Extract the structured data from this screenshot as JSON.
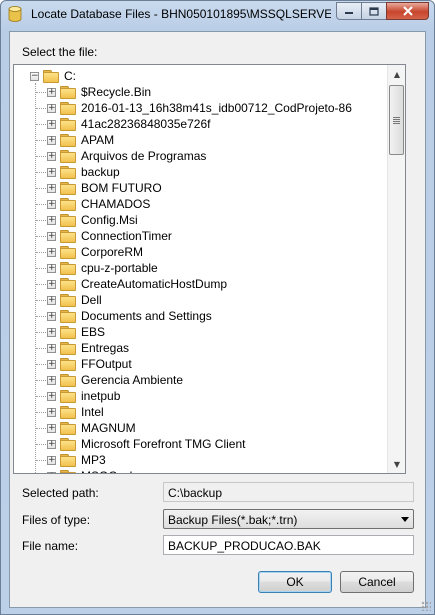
{
  "window": {
    "title": "Locate Database Files - BHN050101895\\MSSQLSERVE...",
    "icon": "database-icon"
  },
  "tree": {
    "label": "Select the file:",
    "root": {
      "label": "C:",
      "expanded": true
    },
    "items": [
      "$Recycle.Bin",
      "2016-01-13_16h38m41s_idb00712_CodProjeto-86",
      "41ac28236848035e726f",
      "APAM",
      "Arquivos de Programas",
      "backup",
      "BOM FUTURO",
      "CHAMADOS",
      "Config.Msi",
      "ConnectionTimer",
      "CorporeRM",
      "cpu-z-portable",
      "CreateAutomaticHostDump",
      "Dell",
      "Documents and Settings",
      "EBS",
      "Entregas",
      "FFOutput",
      "Gerencia  Ambiente",
      "inetpub",
      "Intel",
      "MAGNUM",
      "Microsoft Forefront TMG Client",
      "MP3",
      "MSOCache"
    ]
  },
  "selected_path": {
    "label": "Selected path:",
    "value": "C:\\backup"
  },
  "files_of_type": {
    "label": "Files of type:",
    "value": "Backup Files(*.bak;*.trn)"
  },
  "file_name": {
    "label": "File name:",
    "value": "BACKUP_PRODUCAO.BAK"
  },
  "buttons": {
    "ok": "OK",
    "cancel": "Cancel"
  }
}
